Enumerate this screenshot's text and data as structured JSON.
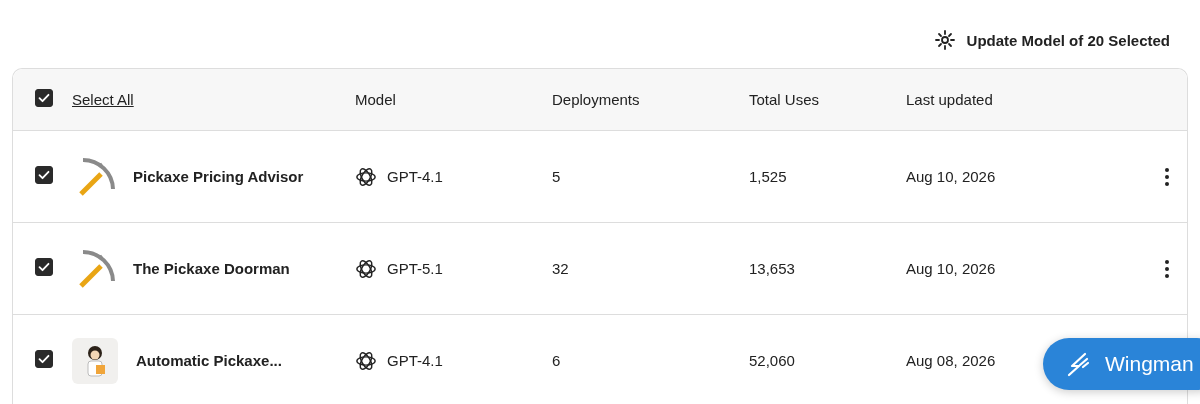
{
  "toolbar": {
    "action": "Update Model of 20 Selected"
  },
  "table": {
    "select_all": {
      "label": "Select All",
      "checked": true
    },
    "columns": [
      "Model",
      "Deployments",
      "Total Uses",
      "Last updated"
    ],
    "rows": [
      {
        "checked": true,
        "kind": "pickaxe",
        "name": "Pickaxe Pricing Advisor",
        "model": "GPT-4.1",
        "deployments": "5",
        "total_uses": "1,525",
        "last_updated": "Aug 10, 2026"
      },
      {
        "checked": true,
        "kind": "pickaxe",
        "name": "The Pickaxe Doorman",
        "model": "GPT-5.1",
        "deployments": "32",
        "total_uses": "13,653",
        "last_updated": "Aug 10, 2026"
      },
      {
        "checked": true,
        "kind": "illustration",
        "name": "Automatic Pickaxe...",
        "model": "GPT-4.1",
        "deployments": "6",
        "total_uses": "52,060",
        "last_updated": "Aug 08, 2026"
      }
    ]
  },
  "floating_button": {
    "label": "Wingman"
  }
}
